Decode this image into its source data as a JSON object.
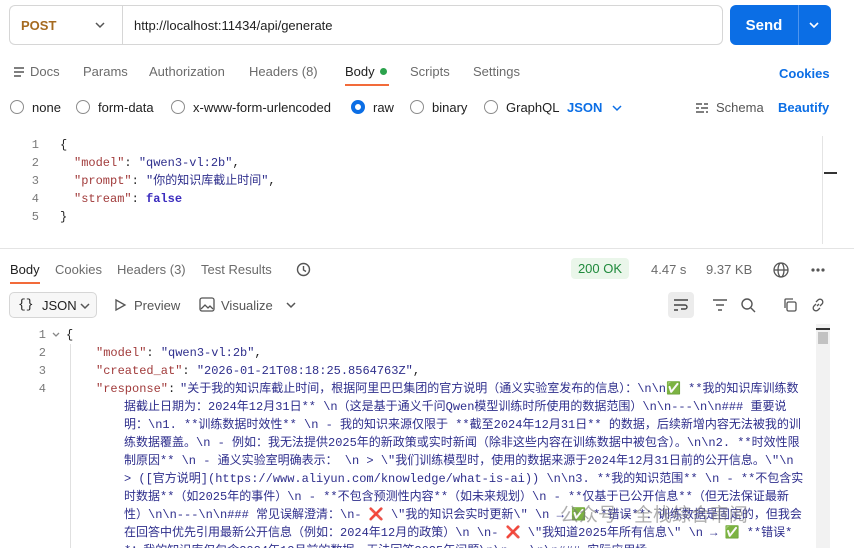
{
  "request": {
    "method": "POST",
    "url": "http://localhost:11434/api/generate",
    "send_label": "Send"
  },
  "request_tabs": {
    "docs": "Docs",
    "params": "Params",
    "authorization": "Authorization",
    "headers": "Headers (8)",
    "body": "Body",
    "scripts": "Scripts",
    "settings": "Settings",
    "cookies": "Cookies"
  },
  "body_types": {
    "none": "none",
    "form_data": "form-data",
    "urlencoded": "x-www-form-urlencoded",
    "raw": "raw",
    "binary": "binary",
    "graphql": "GraphQL",
    "format": "JSON",
    "schema": "Schema",
    "beautify": "Beautify",
    "selected": "raw"
  },
  "request_body": {
    "line_numbers": [
      "1",
      "2",
      "3",
      "4",
      "5"
    ],
    "open": "{",
    "model_key": "\"model\"",
    "model_val": "\"qwen3-vl:2b\"",
    "prompt_key": "\"prompt\"",
    "prompt_val": "\"你的知识库截止时间\"",
    "stream_key": "\"stream\"",
    "stream_val": "false",
    "close": "}"
  },
  "response_tabs": {
    "body": "Body",
    "cookies": "Cookies",
    "headers": "Headers (3)",
    "test_results": "Test Results",
    "status": "200 OK",
    "time": "4.47 s",
    "size": "9.37 KB"
  },
  "response_toolbar": {
    "format": "JSON",
    "preview": "Preview",
    "visualize": "Visualize"
  },
  "response_body": {
    "line_numbers": [
      "1",
      "2",
      "3",
      "4"
    ],
    "open": "{",
    "model_key": "\"model\"",
    "model_val": "\"qwen3-vl:2b\"",
    "created_key": "\"created_at\"",
    "created_val": "\"2026-01-21T08:18:25.8564763Z\"",
    "response_key": "\"response\"",
    "response_val": "\"关于我的知识库截止时间，根据阿里巴巴集团的官方说明（通义实验室发布的信息）：\\n\\n✅ **我的知识库训练数据截止日期为：2024年12月31日**  \\n（这是基于通义千问Qwen模型训练时所使用的数据范围）\\n\\n---\\n\\n### 重要说明：\\n1. **训练数据时效性**  \\n   - 我的知识来源仅限于 **截至2024年12月31日** 的数据，后续新增内容无法被我的训练数据覆盖。\\n   - 例如：我无法提供2025年的新政策或实时新闻（除非这些内容在训练数据中被包含）。\\n\\n2. **时效性限制原因**  \\n   - 通义实验室明确表示：   \\n     > \\\"我们训练模型时，使用的数据来源于2024年12月31日前的公开信息。\\\"\\n     >  ([官方说明](https://www.aliyun.com/knowledge/what-is-ai)) \\n\\n3. **我的知识范围**  \\n   - **不包含实时数据**（如2025年的事件）\\n   - **不包含预测性内容**（如未来规划）\\n   - **仅基于已公开信息**（但无法保证最新性）\\n\\n---\\n\\n### 常见误解澄清：\\n- ❌ \\\"我的知识会实时更新\\\"  \\n  → ✅ **错误**：训练数据是固定的，但我会在回答中优先引用最新公开信息（例如：2024年12月的政策）\\n  \\n- ❌ \\\"我知道2025年所有信息\\\"  \\n  → ✅ **错误**：我的知识库仅包含2024年12月前的数据，无法回答2025年问题\\n\\n---\\n\\n### 实际应用场"
  },
  "watermark": "公众号 · 全栈综合审阅",
  "colors": {
    "accent": "#0b6ee5",
    "method": "#a56a1f",
    "active_tab_underline": "#f26b3a",
    "status_ok": "#1f8a3c"
  }
}
